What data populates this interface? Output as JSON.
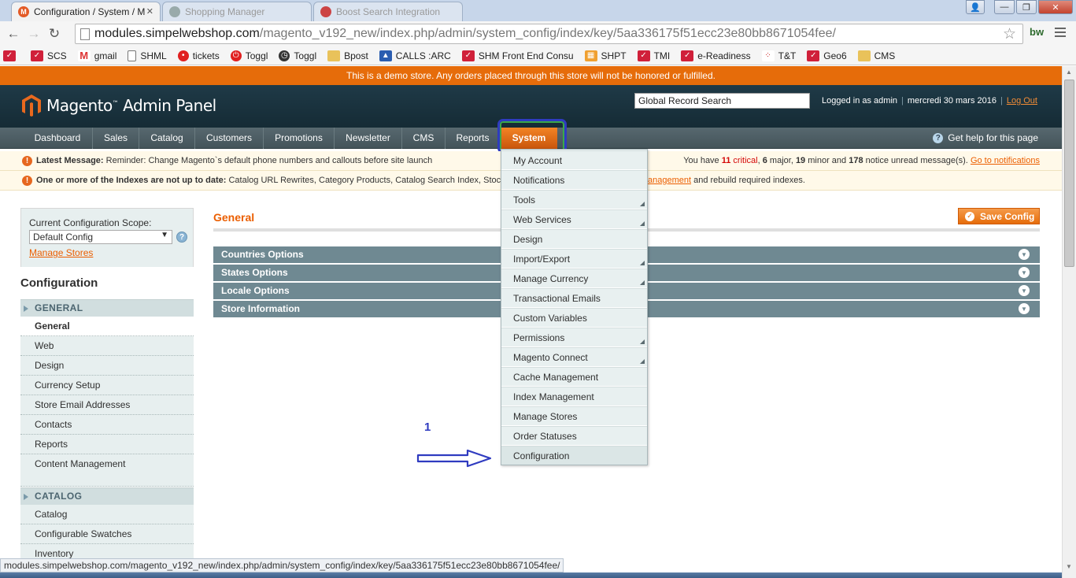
{
  "browser": {
    "tabs": [
      {
        "title": "Configuration / System / M",
        "active": true
      },
      {
        "title": "",
        "active": false
      },
      {
        "title": "Shopping Manager",
        "active": false
      },
      {
        "title": "Boost Search Integration",
        "active": false
      }
    ],
    "url_host": "modules.simpelwebshop.com",
    "url_path": "/magento_v192_new/index.php/admin/system_config/index/key/5aa336175f51ecc23e80bb8671054fee/",
    "extension_label": "bw",
    "bookmarks": [
      {
        "label": "",
        "icon": "bookmark-red-icon"
      },
      {
        "label": "SCS",
        "icon": "bookmark-red-icon"
      },
      {
        "label": "gmail",
        "icon": "gmail-icon"
      },
      {
        "label": "SHML",
        "icon": "page-icon"
      },
      {
        "label": "tickets",
        "icon": "circle-red-icon"
      },
      {
        "label": "Toggl",
        "icon": "power-icon"
      },
      {
        "label": "Toggl",
        "icon": "clock-icon"
      },
      {
        "label": "Bpost",
        "icon": "folder-icon"
      },
      {
        "label": "CALLS :ARC",
        "icon": "upload-icon"
      },
      {
        "label": "SHM Front End Consu",
        "icon": "bookmark-red-icon"
      },
      {
        "label": "SHPT",
        "icon": "grid-icon"
      },
      {
        "label": "TMI",
        "icon": "bookmark-red-icon"
      },
      {
        "label": "e-Readiness",
        "icon": "bookmark-red-icon"
      },
      {
        "label": "T&T",
        "icon": "dots-icon"
      },
      {
        "label": "Geo6",
        "icon": "bookmark-red-icon"
      },
      {
        "label": "CMS",
        "icon": "folder-icon"
      }
    ],
    "status_url": "modules.simpelwebshop.com/magento_v192_new/index.php/admin/system_config/index/key/5aa336175f51ecc23e80bb8671054fee/"
  },
  "demo_notice": "This is a demo store. Any orders placed through this store will not be honored or fulfilled.",
  "header": {
    "logo_text": "Magento",
    "logo_tm": "™",
    "logo_suffix": " Admin Panel",
    "search_value": "Global Record Search",
    "logged_in": "Logged in as admin",
    "date": "mercredi 30 mars 2016",
    "logout": "Log Out"
  },
  "nav": {
    "items": [
      "Dashboard",
      "Sales",
      "Catalog",
      "Customers",
      "Promotions",
      "Newsletter",
      "CMS",
      "Reports",
      "System"
    ],
    "active": "System",
    "help": "Get help for this page"
  },
  "messages": {
    "latest_label": "Latest Message:",
    "latest_text": " Reminder: Change Magento`s default phone numbers and callouts before site launch",
    "counts_prefix": "You have ",
    "critical_count": "11",
    "critical_word": " critical",
    "major_count": "6",
    "major_word": " major, ",
    "minor_count": "19",
    "minor_word": " minor and ",
    "notice_count": "178",
    "notice_word": " notice unread message(s). ",
    "go_to": "Go to notifications",
    "index_label": "One or more of the Indexes are not up to date:",
    "index_text": " Catalog URL Rewrites, Category Products, Catalog Search Index, Stoc",
    "index_link": "anagement",
    "index_suffix": " and rebuild required indexes."
  },
  "sidebar": {
    "scope_label": "Current Configuration Scope:",
    "scope_value": "Default Config",
    "manage_stores": "Manage Stores",
    "title": "Configuration",
    "groups": [
      {
        "label": "GENERAL",
        "items": [
          "General",
          "Web",
          "Design",
          "Currency Setup",
          "Store Email Addresses",
          "Contacts",
          "Reports",
          "Content Management"
        ]
      },
      {
        "label": "CATALOG",
        "items": [
          "Catalog",
          "Configurable Swatches",
          "Inventory"
        ]
      }
    ],
    "active_item": "General"
  },
  "main": {
    "title": "General",
    "save_button": "Save Config",
    "sections": [
      "Countries Options",
      "States Options",
      "Locale Options",
      "Store Information"
    ]
  },
  "system_menu": {
    "items": [
      {
        "label": "My Account",
        "submenu": false
      },
      {
        "label": "Notifications",
        "submenu": false
      },
      {
        "label": "Tools",
        "submenu": true
      },
      {
        "label": "Web Services",
        "submenu": true
      },
      {
        "label": "Design",
        "submenu": false
      },
      {
        "label": "Import/Export",
        "submenu": true
      },
      {
        "label": "Manage Currency",
        "submenu": true
      },
      {
        "label": "Transactional Emails",
        "submenu": false
      },
      {
        "label": "Custom Variables",
        "submenu": false
      },
      {
        "label": "Permissions",
        "submenu": true
      },
      {
        "label": "Magento Connect",
        "submenu": true
      },
      {
        "label": "Cache Management",
        "submenu": false
      },
      {
        "label": "Index Management",
        "submenu": false
      },
      {
        "label": "Manage Stores",
        "submenu": false
      },
      {
        "label": "Order Statuses",
        "submenu": false
      },
      {
        "label": "Configuration",
        "submenu": false
      }
    ]
  },
  "annotation": {
    "step_number": "1",
    "color": "#2f3bc0"
  },
  "colors": {
    "accent": "#e66c0a",
    "header_bg": "#1f3a47",
    "nav_bg": "#4f6066",
    "section_bar": "#6f8992"
  }
}
